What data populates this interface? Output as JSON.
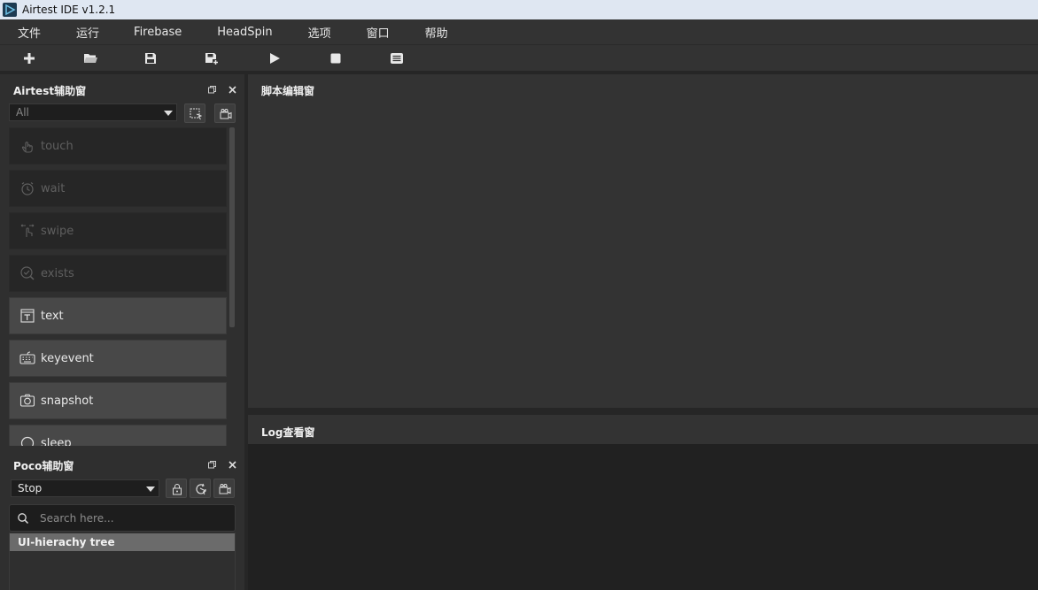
{
  "window": {
    "title": "Airtest IDE v1.2.1"
  },
  "menu": [
    "文件",
    "运行",
    "Firebase",
    "HeadSpin",
    "选项",
    "窗口",
    "帮助"
  ],
  "toolbar": [
    {
      "name": "new-file-icon"
    },
    {
      "name": "open-folder-icon"
    },
    {
      "name": "save-icon"
    },
    {
      "name": "save-as-icon"
    },
    {
      "name": "run-icon"
    },
    {
      "name": "stop-icon"
    },
    {
      "name": "log-list-icon"
    }
  ],
  "airtest_panel": {
    "title": "Airtest辅助窗",
    "filter_value": "All",
    "actions": [
      {
        "label": "touch",
        "icon": "hand-pointer-icon",
        "enabled": false
      },
      {
        "label": "wait",
        "icon": "clock-icon",
        "enabled": false
      },
      {
        "label": "swipe",
        "icon": "swipe-icon",
        "enabled": false
      },
      {
        "label": "exists",
        "icon": "check-circle-icon",
        "enabled": false
      },
      {
        "label": "text",
        "icon": "text-box-icon",
        "enabled": true
      },
      {
        "label": "keyevent",
        "icon": "keyboard-icon",
        "enabled": true
      },
      {
        "label": "snapshot",
        "icon": "camera-icon",
        "enabled": true
      },
      {
        "label": "sleep",
        "icon": "moon-icon",
        "enabled": true
      }
    ]
  },
  "poco_panel": {
    "title": "Poco辅助窗",
    "mode_value": "Stop",
    "search_placeholder": "Search here...",
    "tree_header": "UI-hierachy tree"
  },
  "editor": {
    "title": "脚本编辑窗"
  },
  "log": {
    "title": "Log查看窗"
  },
  "colors": {
    "background": "#2b2b2b",
    "panel": "#333333",
    "log_bg": "#212121",
    "titlebar": "#dfe7f2"
  }
}
